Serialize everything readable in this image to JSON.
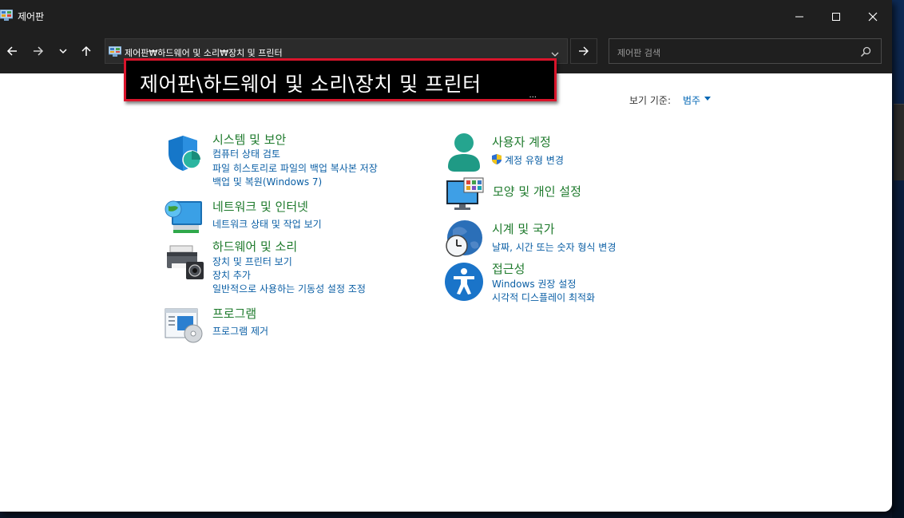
{
  "window": {
    "title": "제어판"
  },
  "nav": {
    "back": "back-arrow",
    "forward": "forward-arrow",
    "recent": "chevron-down",
    "up": "up-arrow"
  },
  "address": {
    "path": "제어판₩하드웨어 및 소리₩장치 및 프린터"
  },
  "search": {
    "placeholder": "제어판 검색"
  },
  "callout": {
    "text": "제어판\\하드웨어 및 소리\\장치 및 프린터",
    "dots": "...",
    "border_color": "#d9142b"
  },
  "view": {
    "label": "보기 기준:",
    "value": "범주"
  },
  "colors": {
    "category_title": "#1e7a2c",
    "link": "#0b5fa5",
    "titlebar": "#1f1f1f"
  },
  "categories": {
    "system": {
      "title": "시스템 및 보안",
      "links": [
        "컴퓨터 상태 검토",
        "파일 히스토리로 파일의 백업 복사본 저장",
        "백업 및 복원(Windows 7)"
      ]
    },
    "network": {
      "title": "네트워크 및 인터넷",
      "links": [
        "네트워크 상태 및 작업 보기"
      ]
    },
    "hardware": {
      "title": "하드웨어 및 소리",
      "links": [
        "장치 및 프린터 보기",
        "장치 추가",
        "일반적으로 사용하는 기동성 설정 조정"
      ]
    },
    "programs": {
      "title": "프로그램",
      "links": [
        "프로그램 제거"
      ]
    },
    "user": {
      "title": "사용자 계정",
      "links": [
        "계정 유형 변경"
      ]
    },
    "appearance": {
      "title": "모양 및 개인 설정",
      "links": []
    },
    "clock": {
      "title": "시계 및 국가",
      "links": [
        "날짜, 시간 또는 숫자 형식 변경"
      ]
    },
    "access": {
      "title": "접근성",
      "links": [
        "Windows 권장 설정",
        "시각적 디스플레이 최적화"
      ]
    }
  }
}
